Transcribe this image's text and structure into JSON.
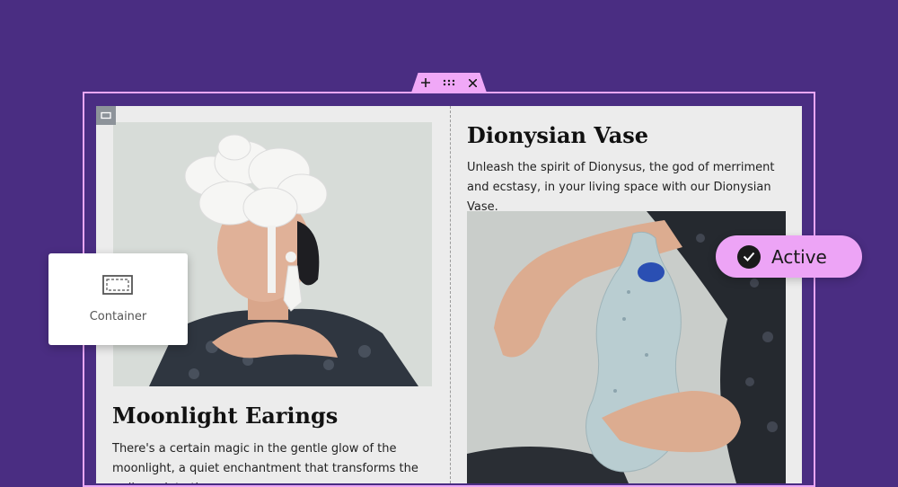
{
  "toolbar": {
    "add_icon": "plus-icon",
    "drag_icon": "drag-handle-icon",
    "close_icon": "close-icon"
  },
  "columns": {
    "left": {
      "title": "Moonlight Earings",
      "body": "There's a certain magic in the gentle glow of the moonlight, a quiet enchantment that transforms the ordinary into the",
      "image": "woman-white-flower-headpiece-photo"
    },
    "right": {
      "title": "Dionysian Vase",
      "body": "Unleash the spirit of Dionysus, the god of merriment and ecstasy, in your living space with our Dionysian Vase.",
      "image": "hands-holding-ceramic-vase-photo"
    }
  },
  "container_widget": {
    "label": "Container",
    "icon": "container-icon"
  },
  "status": {
    "label": "Active",
    "icon": "check-circle-icon"
  },
  "colors": {
    "background": "#4a2d82",
    "accent_pink": "#eda4f6",
    "canvas": "#ececec"
  }
}
